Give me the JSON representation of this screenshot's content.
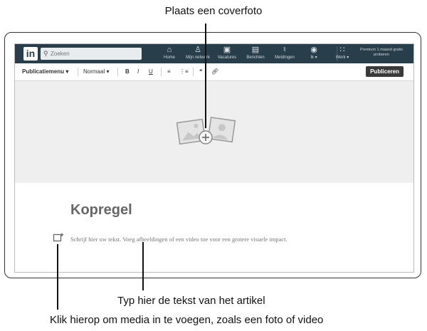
{
  "callouts": {
    "cover": "Plaats een coverfoto",
    "text": "Typ hier de tekst van het artikel",
    "media": "Klik hierop om media in te voegen, zoals een foto of video"
  },
  "nav": {
    "logo": "in",
    "search_placeholder": "Zoeken",
    "items": [
      {
        "label": "Home",
        "icon": "home-icon"
      },
      {
        "label": "Mijn netwerk",
        "icon": "network-icon"
      },
      {
        "label": "Vacatures",
        "icon": "briefcase-icon"
      },
      {
        "label": "Berichten",
        "icon": "messages-icon"
      },
      {
        "label": "Meldingen",
        "icon": "bell-icon"
      },
      {
        "label": "Ik ▾",
        "icon": "avatar-icon"
      },
      {
        "label": "Werk ▾",
        "icon": "grid-icon"
      }
    ],
    "premium": "Premium 1 maand gratis proberen"
  },
  "toolbar": {
    "menu": "Publicatiemenu",
    "style": "Normaal",
    "bold": "B",
    "italic": "I",
    "underline": "U",
    "publish": "Publiceren"
  },
  "article": {
    "headline": "Kopregel",
    "body_placeholder": "Schrijf hier uw tekst. Voeg afbeeldingen of een video toe voor een grotere visuele impact."
  },
  "colors": {
    "nav_bg": "#283e4a",
    "cover_bg": "#efefef",
    "publish_bg": "#3a3a3a"
  }
}
